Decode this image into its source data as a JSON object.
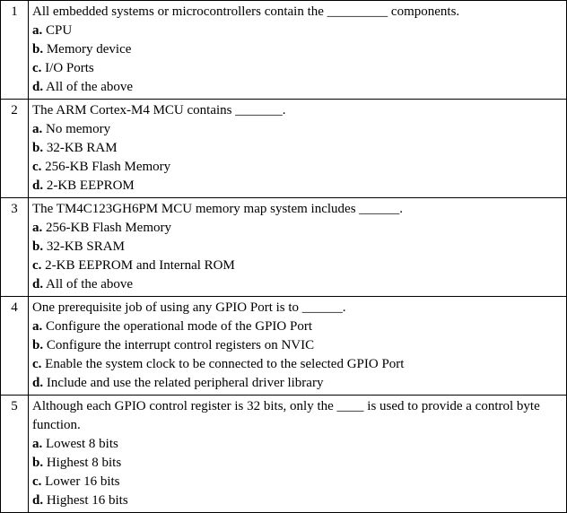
{
  "questions": [
    {
      "num": "1",
      "stem": "All embedded systems or microcontrollers contain the _________ components.",
      "options": [
        {
          "letter": "a.",
          "text": "CPU"
        },
        {
          "letter": "b.",
          "text": "Memory device"
        },
        {
          "letter": "c.",
          "text": "I/O Ports"
        },
        {
          "letter": "d.",
          "text": "All of the above"
        }
      ]
    },
    {
      "num": "2",
      "stem": "The ARM Cortex-M4 MCU contains _______.",
      "options": [
        {
          "letter": "a.",
          "text": "No memory"
        },
        {
          "letter": "b.",
          "text": "32-KB RAM"
        },
        {
          "letter": "c.",
          "text": "256-KB Flash Memory"
        },
        {
          "letter": "d.",
          "text": "2-KB EEPROM"
        }
      ]
    },
    {
      "num": "3",
      "stem": "The TM4C123GH6PM MCU memory map system includes ______.",
      "options": [
        {
          "letter": "a.",
          "text": "256-KB Flash Memory"
        },
        {
          "letter": "b.",
          "text": "32-KB SRAM"
        },
        {
          "letter": "c.",
          "text": "2-KB EEPROM and Internal ROM"
        },
        {
          "letter": "d.",
          "text": "All of the above"
        }
      ]
    },
    {
      "num": "4",
      "stem": "One prerequisite job of using any GPIO Port is to ______.",
      "options": [
        {
          "letter": "a.",
          "text": "Configure the operational mode of the GPIO Port"
        },
        {
          "letter": "b.",
          "text": "Configure the interrupt control registers on NVIC"
        },
        {
          "letter": "c.",
          "text": "Enable the system clock to be connected to the selected GPIO Port"
        },
        {
          "letter": "d.",
          "text": "Include and use the related peripheral driver library"
        }
      ]
    },
    {
      "num": "5",
      "stem": "Although each GPIO control register is 32 bits, only the ____ is used to provide a control byte function.",
      "options": [
        {
          "letter": "a.",
          "text": "Lowest 8 bits"
        },
        {
          "letter": "b.",
          "text": "Highest 8 bits"
        },
        {
          "letter": "c.",
          "text": "Lower 16 bits"
        },
        {
          "letter": "d.",
          "text": "Highest 16 bits"
        }
      ]
    }
  ]
}
